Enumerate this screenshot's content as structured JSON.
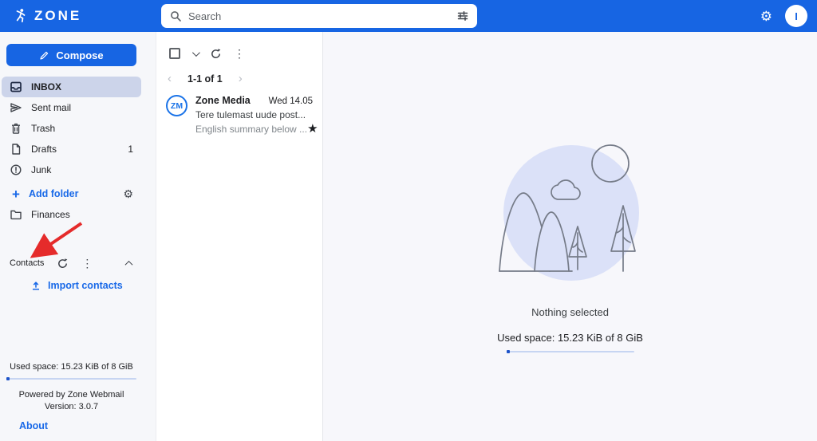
{
  "topbar": {
    "brand": "ZONE",
    "search_placeholder": "Search",
    "avatar_letter": "I"
  },
  "icons": {
    "plus": "+",
    "kebab": "⋮",
    "star": "★",
    "gear": "⚙",
    "chevron_left": "‹",
    "chevron_right": "›"
  },
  "colors": {
    "brand_blue": "#1765e3",
    "link_blue": "#1a6ae8",
    "active_item_bg": "#ccd4ea",
    "illustration_fill": "#dbe1f8",
    "arrow_red": "#e52b2b"
  },
  "sidebar": {
    "compose_label": "Compose",
    "folders": [
      {
        "label": "INBOX"
      },
      {
        "label": "Sent mail"
      },
      {
        "label": "Trash"
      },
      {
        "label": "Drafts",
        "count": "1"
      },
      {
        "label": "Junk"
      }
    ],
    "add_folder_label": "Add folder",
    "custom_folders": [
      {
        "label": "Finances"
      }
    ],
    "contacts": {
      "label": "Contacts",
      "import_label": "Import contacts"
    },
    "used_space": "Used space: 15.23 KiB of 8 GiB",
    "powered_by": "Powered by Zone Webmail",
    "version": "Version: 3.0.7",
    "about_label": "About"
  },
  "maillist": {
    "pagination": "1-1 of 1",
    "emails": [
      {
        "initials": "ZM",
        "sender": "Zone Media",
        "date": "Wed 14.05",
        "subject": "Tere tulemast uude post...",
        "preview": "English summary below ..."
      }
    ]
  },
  "content": {
    "empty_title": "Nothing selected",
    "used_space": "Used space: 15.23 KiB of 8 GiB"
  }
}
